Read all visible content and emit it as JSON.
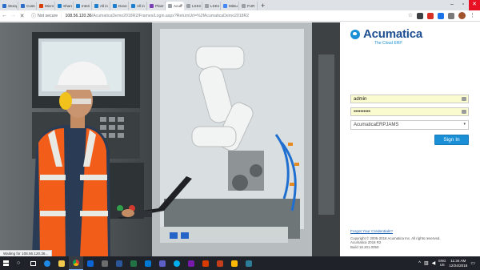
{
  "tabs": [
    {
      "title": "Storą",
      "color": "#2b6ec9",
      "active": false
    },
    {
      "title": "Custo",
      "color": "#2b6ec9",
      "active": false
    },
    {
      "title": "Micro",
      "color": "#d83b01",
      "active": false
    },
    {
      "title": "Share",
      "color": "#1b7ecf",
      "active": false
    },
    {
      "title": "Interi",
      "color": "#1b7ecf",
      "active": false
    },
    {
      "title": "All in",
      "color": "#1b7ecf",
      "active": false
    },
    {
      "title": "Deve",
      "color": "#1b7ecf",
      "active": false
    },
    {
      "title": "All in",
      "color": "#1b7ecf",
      "active": false
    },
    {
      "title": "Plann",
      "color": "#7a3fb5",
      "active": false
    },
    {
      "title": "Acum",
      "color": "#9aa0a6",
      "active": true
    },
    {
      "title": "LSKn",
      "color": "#9aa0a6",
      "active": false
    },
    {
      "title": "LSKn",
      "color": "#9aa0a6",
      "active": false
    },
    {
      "title": "Mitsu",
      "color": "#4285f4",
      "active": false
    },
    {
      "title": "FUR",
      "color": "#9aa0a6",
      "active": false
    }
  ],
  "browser": {
    "reload_glyph": "✕",
    "security_label": "Not secure",
    "url_host": "108.56.120.36",
    "url_path": "/AcumaticaDemo2018R2/Frames/Login.aspx?ReturnUrl=%2fAcumaticaDemo2018R2",
    "new_tab_glyph": "+",
    "menu_glyph": "⋮"
  },
  "login": {
    "brand": "Acumatica",
    "tagline": "The Cloud ERP",
    "username_value": "admin",
    "password_value": "••••••••••",
    "company_value": "AcumaticaERPJAMS",
    "signin_label": "Sign In",
    "forgot_label": "Forgot Your Credentials?",
    "copyright": "Copyright © 2005-2018 Acumatica Inc. All rights reserved.",
    "version": "Acumatica 2018 R2",
    "build": "Build 18.201.0050"
  },
  "status_text": "Waiting for 108.56.120.36...",
  "taskbar": {
    "lang_top": "ENG",
    "lang_bottom": "US",
    "time": "11:34 AM",
    "date": "12/24/2018"
  }
}
